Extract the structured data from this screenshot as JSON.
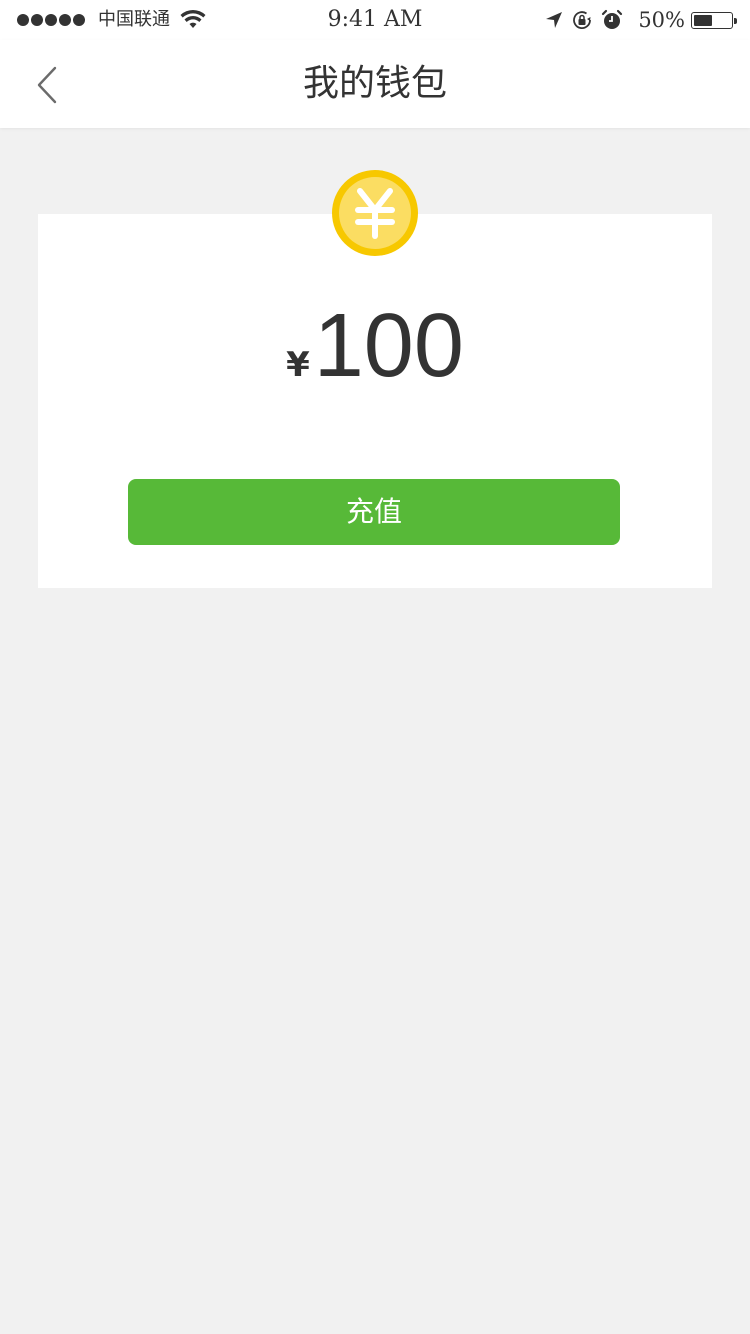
{
  "status_bar": {
    "carrier": "中国联通",
    "time": "9:41 AM",
    "battery_percent": "50%",
    "battery_level": 0.5,
    "icons": [
      "signal-dots",
      "wifi-icon",
      "location-arrow-icon",
      "rotation-lock-icon",
      "alarm-icon",
      "battery-icon"
    ]
  },
  "nav": {
    "title": "我的钱包",
    "back_icon": "chevron-left-icon"
  },
  "wallet": {
    "coin_icon": "yuan-coin-icon",
    "currency_symbol": "¥",
    "balance": "100",
    "recharge_label": "充值"
  },
  "colors": {
    "accent_green": "#57b938",
    "coin_yellow": "#f7c800",
    "page_background": "#f1f1f1",
    "card_background": "#ffffff",
    "text_dark": "#333333"
  }
}
